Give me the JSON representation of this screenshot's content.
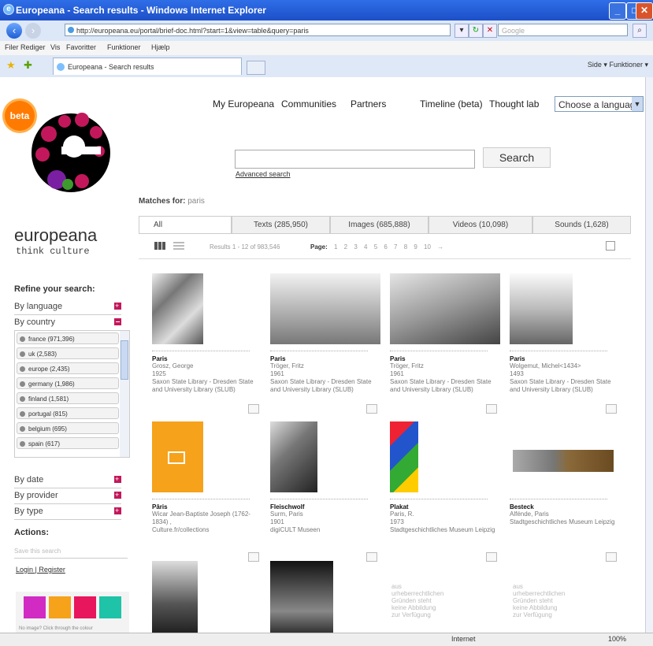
{
  "window": {
    "title": "Europeana - Search results - Windows Internet Explorer",
    "url": "http://europeana.eu/portal/brief-doc.html?start=1&view=table&query=paris",
    "search_placeholder": "Google",
    "minimize": "_",
    "maximize": "□",
    "close": "✕"
  },
  "menu": [
    "Filer",
    "Rediger",
    "Vis",
    "Favoritter",
    "Funktioner",
    "Hjælp"
  ],
  "tab": {
    "label": "Europeana - Search results"
  },
  "toolbar_right": "Side ▾  Funktioner ▾",
  "status": {
    "zone": "Internet",
    "zoom": "100%"
  },
  "brand": {
    "badge": "beta",
    "name": "europeana",
    "tagline": "think culture"
  },
  "topnav": [
    "My Europeana",
    "Communities",
    "Partners",
    "Timeline (beta)",
    "Thought lab"
  ],
  "language_select": "Choose a language",
  "search": {
    "button": "Search",
    "advanced": "Advanced search",
    "matches_label": "Matches for:",
    "query": "paris"
  },
  "type_tabs": [
    "All",
    "Texts (285,950)",
    "Images (685,888)",
    "Videos (10,098)",
    "Sounds (1,628)"
  ],
  "results_bar": {
    "count": "Results 1 - 12 of 983,546",
    "page_label": "Page:",
    "pages": "1  2  3  4  5  6  7  8  9  10  →"
  },
  "refine": {
    "title": "Refine your search:",
    "facets_top": [
      "By language",
      "By country"
    ],
    "countries": [
      "france (971,396)",
      "uk (2,583)",
      "europe (2,435)",
      "germany (1,986)",
      "finland (1,581)",
      "portugal (815)",
      "belgium (695)",
      "spain (617)"
    ],
    "facets_bottom": [
      "By date",
      "By provider",
      "By type"
    ],
    "actions_title": "Actions:",
    "save_search": "Save this search",
    "login": "Login | Register",
    "promo_caption": "No image? Click through the colour"
  },
  "results": [
    {
      "title": "Paris",
      "meta": [
        "Grosz, George",
        "1925",
        "Saxon State Library - Dresden State and University Library (SLUB)"
      ]
    },
    {
      "title": "Paris",
      "meta": [
        "Tröger, Fritz",
        "1961",
        "Saxon State Library - Dresden State and University Library (SLUB)"
      ]
    },
    {
      "title": "Paris",
      "meta": [
        "Tröger, Fritz",
        "1961",
        "Saxon State Library - Dresden State and University Library (SLUB)"
      ]
    },
    {
      "title": "Paris",
      "meta": [
        "Wolgemut, Michel<1434>",
        "1493",
        "Saxon State Library - Dresden State and University Library (SLUB)"
      ]
    },
    {
      "title": "Pâris",
      "meta": [
        "Wicar Jean-Baptiste Joseph (1762-1834) ,",
        "Culture.fr/collections"
      ]
    },
    {
      "title": "Fleischwolf",
      "meta": [
        "Surm, Paris",
        "1901",
        "digiCULT Museen"
      ]
    },
    {
      "title": "Plakat",
      "meta": [
        "Paris, R.",
        "1973",
        "Stadtgeschichtliches Museum Leipzig"
      ]
    },
    {
      "title": "Besteck",
      "meta": [
        "Alfénde, Paris",
        "Stadtgeschichtliches Museum Leipzig"
      ]
    }
  ],
  "no_image_text": [
    "aus",
    "urheberrechtlichen",
    "Gründen steht",
    "keine Abbildung",
    "zur Verfügung"
  ]
}
